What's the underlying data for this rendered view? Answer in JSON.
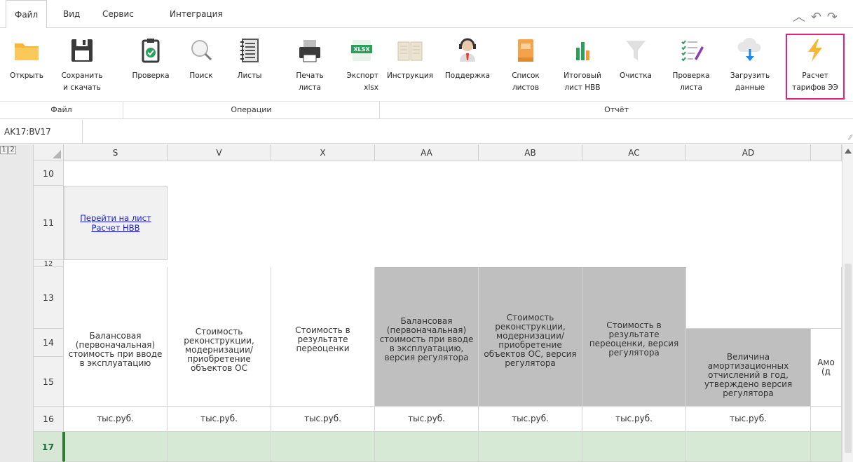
{
  "menu": {
    "tabs": [
      "Файл",
      "Вид",
      "Сервис",
      "Интеграция"
    ]
  },
  "ribbon": {
    "buttons": [
      {
        "line1": "Открыть",
        "line2": "",
        "icon": "folder-icon"
      },
      {
        "line1": "Сохранить",
        "line2": "и скачать",
        "icon": "save-icon"
      },
      {
        "line1": "Проверка",
        "line2": "",
        "icon": "clipboard-check-icon"
      },
      {
        "line1": "Поиск",
        "line2": "",
        "icon": "search-icon"
      },
      {
        "line1": "Листы",
        "line2": "",
        "icon": "notebook-icon"
      },
      {
        "line1": "Печать",
        "line2": "листа",
        "icon": "printer-icon"
      },
      {
        "line1": "Экспорт",
        "line2": "xlsx",
        "icon": "xlsx-icon"
      },
      {
        "line1": "Инструкция",
        "line2": "",
        "icon": "book-icon"
      },
      {
        "line1": "Поддержка",
        "line2": "",
        "icon": "headset-icon"
      },
      {
        "line1": "Список",
        "line2": "листов",
        "icon": "list-book-icon"
      },
      {
        "line1": "Итоговый",
        "line2": "лист НВВ",
        "icon": "bar-chart-icon"
      },
      {
        "line1": "Очистка",
        "line2": "",
        "icon": "filter-icon"
      },
      {
        "line1": "Проверка",
        "line2": "листа",
        "icon": "checklist-icon"
      },
      {
        "line1": "Загрузить",
        "line2": "данные",
        "icon": "cloud-download-icon"
      },
      {
        "line1": "Расчет",
        "line2": "тарифов ЭЭ",
        "icon": "lightning-icon"
      }
    ],
    "groups": {
      "file": "Файл",
      "operations": "Операции",
      "report": "Отчёт"
    }
  },
  "namebox": "AK17:BV17",
  "outline_levels": [
    "1",
    "2"
  ],
  "columns": [
    "S",
    "V",
    "X",
    "AA",
    "AB",
    "AC",
    "AD"
  ],
  "rows": [
    "10",
    "11",
    "12",
    "13",
    "14",
    "15",
    "16",
    "17"
  ],
  "link": {
    "line1": "Перейти на лист",
    "line2": "Расчет НВВ"
  },
  "headers": {
    "S": "Балансовая (первоначальная) стоимость при вводе в эксплуатацию",
    "V": "Стоимость реконструкции, модернизации/приобретение объектов ОС",
    "X": "Стоимость в результате переоценки",
    "AA": "Балансовая (первоначальная) стоимость при вводе в эксплуатацию, версия регулятора",
    "AB": "Стоимость реконструкции, модернизации/приобретение объектов ОС, версия регулятора",
    "AC": "Стоимость в результате переоценки, версия регулятора",
    "AD": "Величина амортизационных отчислений в год, утверждено версия регулятора",
    "partial": "Амо (д"
  },
  "units": "тыс.руб.",
  "colors": {
    "highlight": "#e2217a",
    "grey_cell": "#bfbfbf",
    "selected_row": "#d6e9d4",
    "link": "#1a1ae6"
  }
}
